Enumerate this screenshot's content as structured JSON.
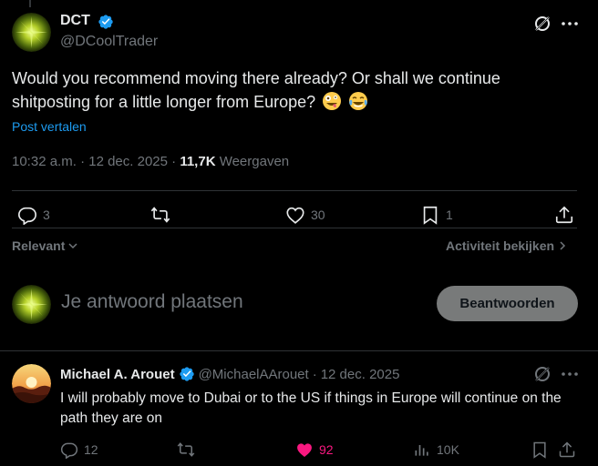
{
  "post": {
    "author_name": "DCT",
    "author_handle": "@DCoolTrader",
    "text": "Would you recommend moving there already? Or shall we continue shitposting for a little longer from Europe?",
    "translate_label": "Post vertalen",
    "time": "10:32 a.m.",
    "date": "12 dec. 2025",
    "separator": "·",
    "views_count": "11,7K",
    "views_label": "Weergaven",
    "replies": "3",
    "reposts": "",
    "likes": "30",
    "bookmarks": "1"
  },
  "sort": {
    "relevant_label": "Relevant",
    "activity_label": "Activiteit bekijken"
  },
  "composer": {
    "placeholder": "Je antwoord plaatsen",
    "reply_button": "Beantwoorden"
  },
  "reply": {
    "author_name": "Michael A. Arouet",
    "author_handle": "@MichaelAArouet",
    "date": "12 dec. 2025",
    "separator": "·",
    "text": "I will probably move to Dubai or to the US if things in Europe will continue on the path they are on",
    "replies": "12",
    "likes": "92",
    "views": "10K"
  },
  "colors": {
    "accent": "#1d9bf0",
    "like_active": "#f91880",
    "muted": "#71767b"
  }
}
